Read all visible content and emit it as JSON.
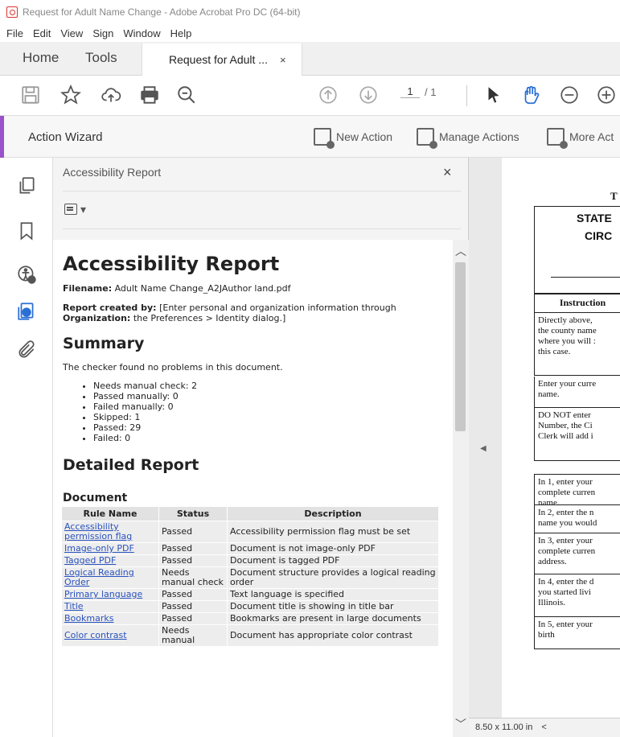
{
  "window": {
    "title": "Request for Adult Name Change - Adobe Acrobat Pro DC (64-bit)"
  },
  "menu": [
    "File",
    "Edit",
    "View",
    "Sign",
    "Window",
    "Help"
  ],
  "tabs": {
    "home": "Home",
    "tools": "Tools",
    "document": "Request for Adult ...",
    "close": "×"
  },
  "toolbar": {
    "page_current": "1",
    "page_total": "/ 1"
  },
  "action_wizard": {
    "title": "Action Wizard",
    "new_action": "New Action",
    "manage_actions": "Manage Actions",
    "more_actions": "More Act",
    "accent": "#9b51c9"
  },
  "panel": {
    "title": "Accessibility Report",
    "close": "×",
    "options_caret": "▾"
  },
  "report": {
    "title": "Accessibility Report",
    "filename_label": "Filename:",
    "filename": "Adult Name Change_A2JAuthor land.pdf",
    "created_by_label": "Report created by:",
    "created_by": "[Enter personal and organization information through",
    "organization_label": "Organization:",
    "organization": "the Preferences > Identity dialog.]",
    "summary_heading": "Summary",
    "summary_text": "The checker found no problems in this document.",
    "summary_items": [
      "Needs manual check: 2",
      "Passed manually: 0",
      "Failed manually: 0",
      "Skipped: 1",
      "Passed: 29",
      "Failed: 0"
    ],
    "detailed_heading": "Detailed Report",
    "section": "Document",
    "columns": [
      "Rule Name",
      "Status",
      "Description"
    ],
    "rows": [
      {
        "rule": "Accessibility permission flag",
        "status": "Passed",
        "description": "Accessibility permission flag must be set"
      },
      {
        "rule": "Image-only PDF",
        "status": "Passed",
        "description": "Document is not image-only PDF"
      },
      {
        "rule": "Tagged PDF",
        "status": "Passed",
        "description": "Document is tagged PDF"
      },
      {
        "rule": "Logical Reading Order",
        "status": "Needs manual check",
        "description": "Document structure provides a logical reading order"
      },
      {
        "rule": "Primary language",
        "status": "Passed",
        "description": "Text language is specified"
      },
      {
        "rule": "Title",
        "status": "Passed",
        "description": "Document title is showing in title bar"
      },
      {
        "rule": "Bookmarks",
        "status": "Passed",
        "description": "Bookmarks are present in large documents"
      },
      {
        "rule": "Color contrast",
        "status": "Needs manual",
        "description": "Document has appropriate color contrast"
      }
    ]
  },
  "document": {
    "header_partial": "T",
    "state_partial": "STATE",
    "circuit_partial": "CIRC",
    "instructions_partial": "Instruction",
    "cells": [
      [
        "Directly above,",
        "the county name",
        "where you will :",
        "this case."
      ],
      [
        "Enter your curre",
        "name."
      ],
      [
        "DO NOT enter",
        "Number, the Ci",
        "Clerk will add i"
      ],
      [
        "In 1, enter your",
        "complete curren",
        "name."
      ],
      [
        "In 2, enter the n",
        "name you would"
      ],
      [
        "In 3, enter your",
        "complete curren",
        "address."
      ],
      [
        "In 4, enter the d",
        "you started livi",
        "Illinois."
      ],
      [
        "In 5, enter your",
        "birth"
      ]
    ],
    "page_size": "8.50 x 11.00 in",
    "nav_prev": "<"
  }
}
